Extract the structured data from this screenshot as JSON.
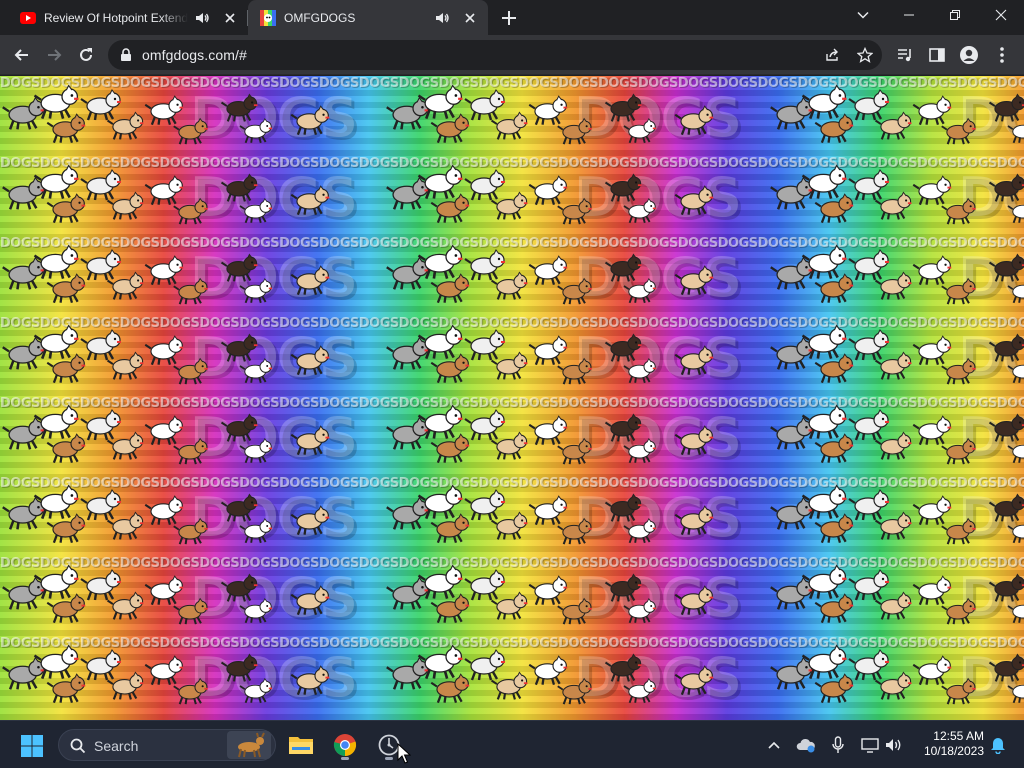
{
  "browser": {
    "tabs": [
      {
        "title": "Review Of Hotpoint Extending",
        "favicon": "youtube-icon",
        "audio": true,
        "active": false
      },
      {
        "title": "OMFGDOGS",
        "favicon": "omfgdogs-favicon",
        "audio": true,
        "active": true
      }
    ],
    "new_tab_icon": "plus-icon",
    "window_controls": [
      "tab-search-icon",
      "minimize-icon",
      "restore-icon",
      "close-icon"
    ],
    "toolbar": {
      "url": "omfgdogs.com/#",
      "left_icons": [
        "back-icon",
        "forward-icon",
        "reload-icon"
      ],
      "right_icons": [
        "share-icon",
        "bookmark-star-icon",
        "media-control-icon",
        "side-panel-icon",
        "profile-icon",
        "menu-icon"
      ]
    }
  },
  "page": {
    "word_strip": "DOGSDOGSDOGSDOGSDOGSDOGSDOGSDOGSDOGSDOGSDOGSDOGSDOGSDOGSDOGSDOGSDOGSDOGSDOGSDOGSDOGSDOGSDOGSDOGSDOGSDOGSDOGSDOGSDOGSDOGS",
    "big_letters": "DOGS",
    "rainbow_colors": [
      "#9be13b",
      "#f3e33b",
      "#f29a2e",
      "#e8453c",
      "#d52fbf",
      "#6b3be0",
      "#3a6df0",
      "#45c6f0",
      "#3bd56a"
    ],
    "dog_colors": [
      "#ffffff",
      "#a9a9a9",
      "#c8874a",
      "#3c2a22",
      "#e8c9a0",
      "#f0f0f0"
    ]
  },
  "taskbar": {
    "search_label": "Search",
    "apps": [
      "file-explorer-icon",
      "chrome-icon",
      "screen-recorder-icon"
    ],
    "tray_icons": [
      "chevron-up-icon",
      "onedrive-icon",
      "microphone-icon",
      "display-icon",
      "volume-icon",
      "notification-bell-icon"
    ],
    "time": "12:55 AM",
    "date": "10/18/2023"
  },
  "colors": {
    "tab_bg": "#202124",
    "active_tab_bg": "#35363a",
    "taskbar_bg": "#1f2532",
    "text": "#e8eaed"
  }
}
